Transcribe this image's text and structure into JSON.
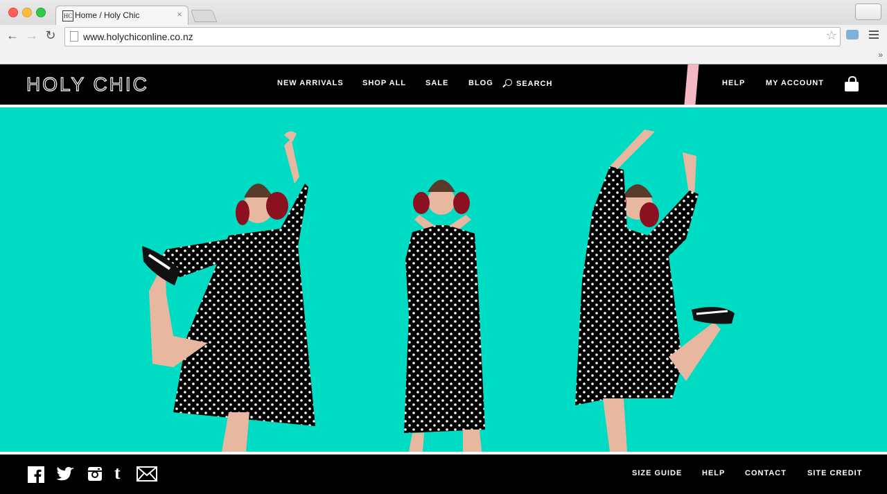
{
  "browser": {
    "tab_title": "Home / Holy Chic",
    "favicon_text": "HC",
    "tab_close": "×",
    "url": "www.holychiconline.co.nz",
    "star": "☆",
    "bookmark_chevron": "»"
  },
  "header": {
    "logo": "HOLY CHIC",
    "nav": [
      "NEW ARRIVALS",
      "SHOP ALL",
      "SALE",
      "BLOG",
      "SEARCH"
    ],
    "right_nav": [
      "HELP",
      "MY ACCOUNT"
    ],
    "accent_pink": "#f4b8c3"
  },
  "hero": {
    "background": "#00dcc4",
    "dress_color": "#000000",
    "earmuff_color": "#8b1020"
  },
  "footer": {
    "social_icons": [
      "facebook-icon",
      "twitter-icon",
      "instagram-icon",
      "tumblr-icon",
      "email-icon"
    ],
    "tumblr_glyph": "t",
    "links": [
      "SIZE GUIDE",
      "HELP",
      "CONTACT",
      "SITE CREDIT"
    ]
  }
}
